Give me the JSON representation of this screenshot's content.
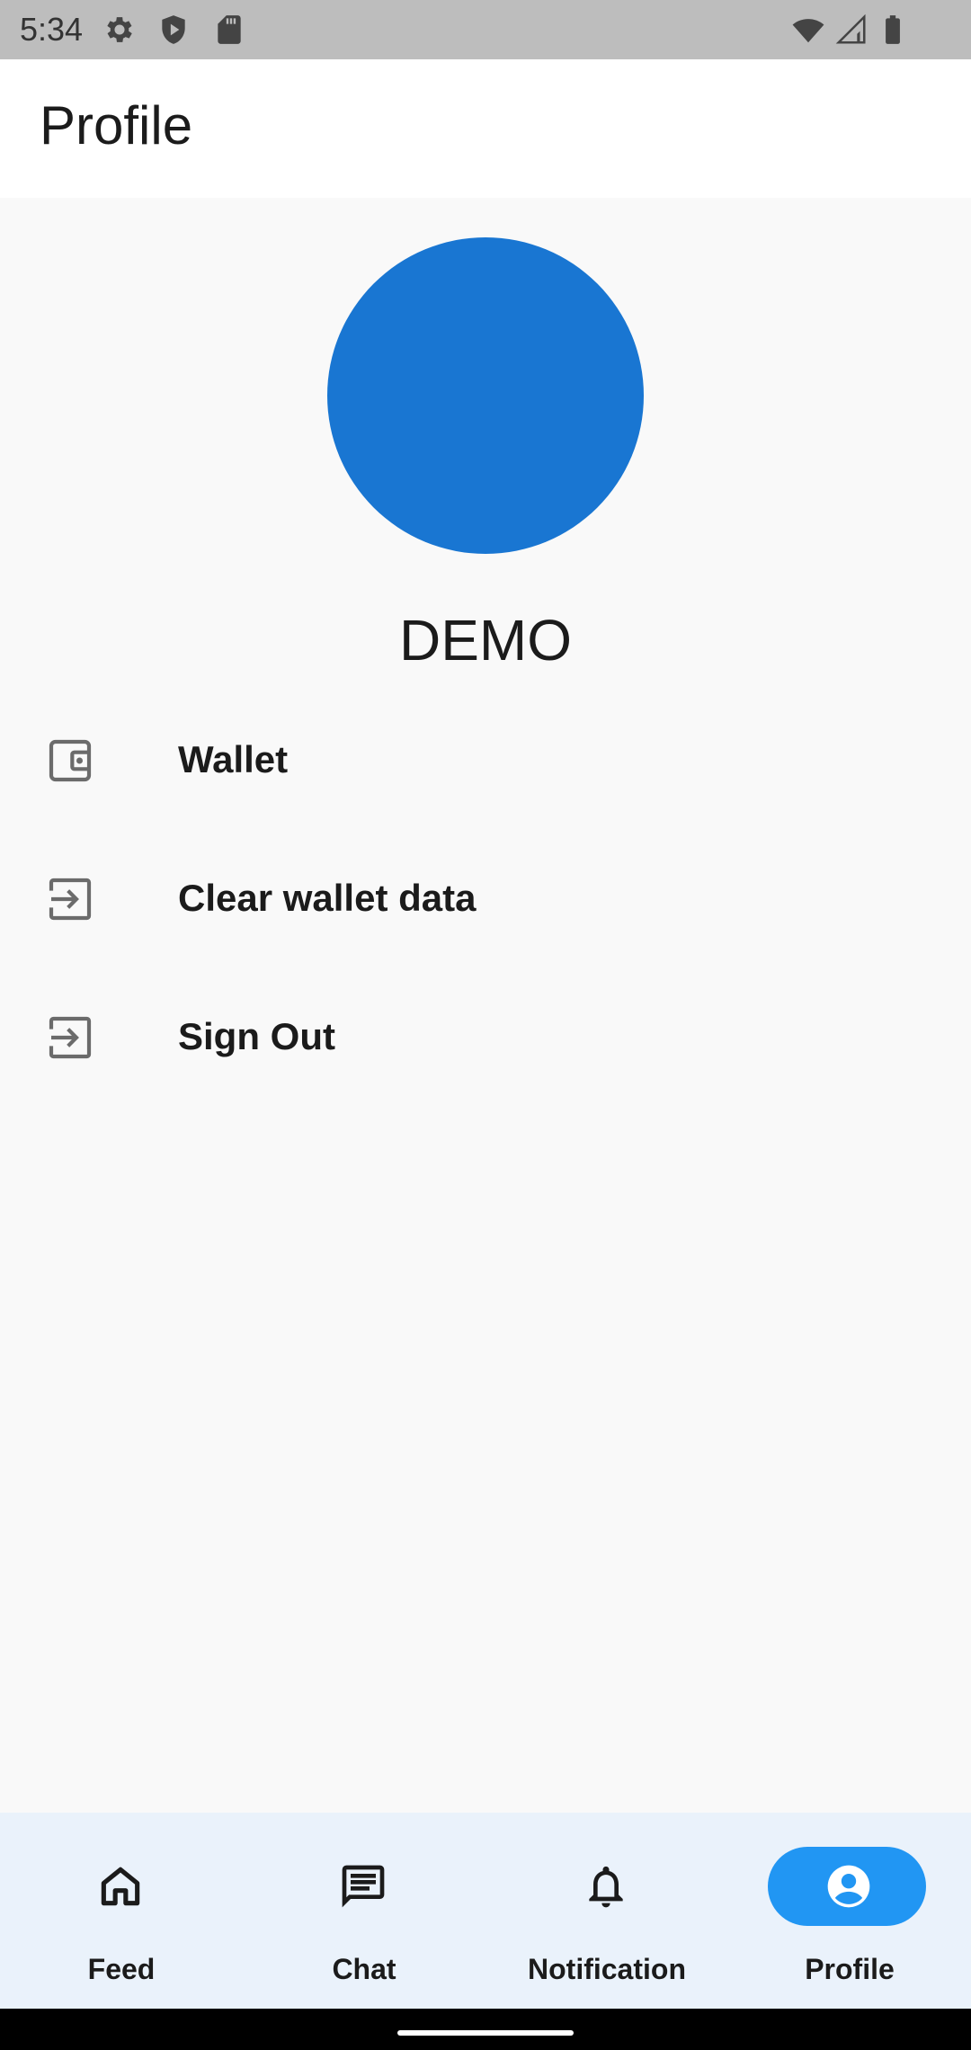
{
  "status_bar": {
    "time": "5:34",
    "icons": [
      "gear-icon",
      "shield-play-icon",
      "sd-card-icon",
      "wifi-icon",
      "signal-icon",
      "battery-icon"
    ]
  },
  "app_bar": {
    "title": "Profile"
  },
  "profile": {
    "name": "DEMO",
    "avatar_color": "#1976d2"
  },
  "menu": {
    "items": [
      {
        "label": "Wallet",
        "icon": "wallet-icon"
      },
      {
        "label": "Clear wallet data",
        "icon": "login-arrow-icon"
      },
      {
        "label": "Sign Out",
        "icon": "login-arrow-icon"
      }
    ]
  },
  "bottom_nav": {
    "items": [
      {
        "label": "Feed",
        "icon": "home-icon",
        "selected": false
      },
      {
        "label": "Chat",
        "icon": "chat-icon",
        "selected": false
      },
      {
        "label": "Notification",
        "icon": "bell-icon",
        "selected": false
      },
      {
        "label": "Profile",
        "icon": "account-circle-icon",
        "selected": true
      }
    ],
    "background": "#eaf2fb",
    "indicator_color": "#2196f3"
  }
}
